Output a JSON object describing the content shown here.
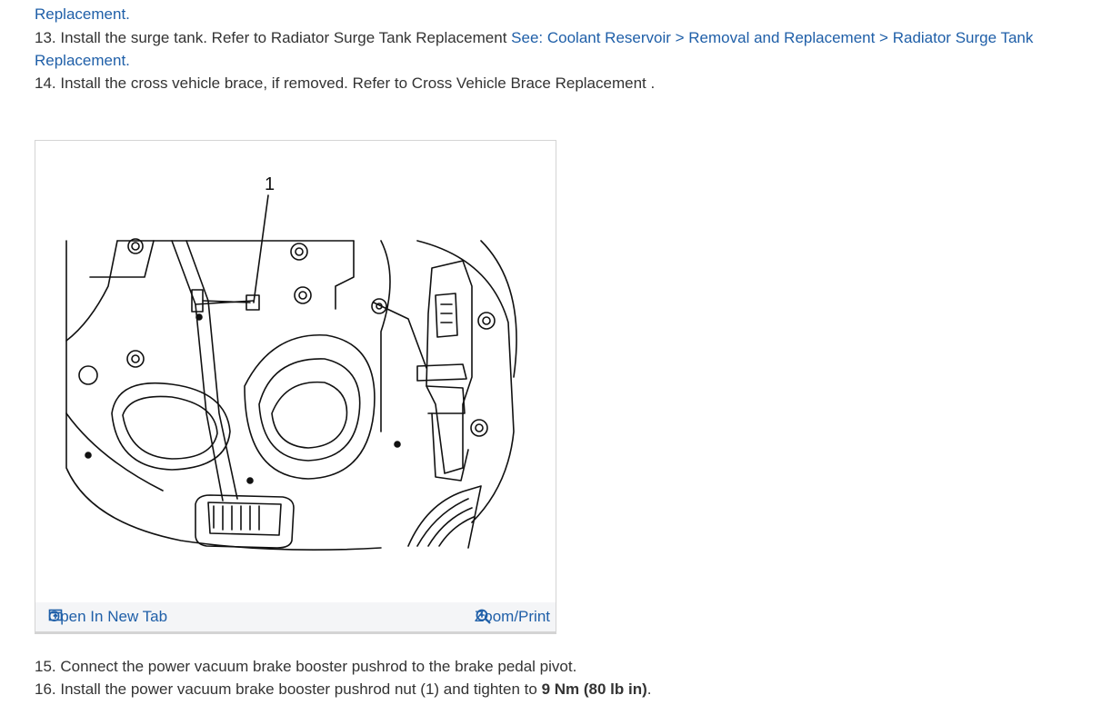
{
  "steps": {
    "s12_tail": "Replacement.",
    "s13_text": "13. Install the surge tank. Refer to Radiator Surge Tank Replacement ",
    "s13_link_a": "See: Coolant Reservoir > Removal and Replacement > Radiator Surge Tank",
    "s13_link_b": "Replacement.",
    "s14_text": "14. Install the cross vehicle brace, if removed. Refer to Cross Vehicle Brace Replacement .",
    "s15_text": "15. Connect the power vacuum brake booster pushrod to the brake pedal pivot.",
    "s16_text": "16. Install the power vacuum brake booster pushrod nut (1) and tighten to ",
    "s16_bold": "9 Nm (80 lb in)",
    "s16_end": "."
  },
  "figure": {
    "callout": "1",
    "open_label": "Open In New Tab",
    "zoom_label": "Zoom/Print",
    "open_icon": "open-in-new-tab-icon",
    "zoom_icon": "zoom-in-icon"
  },
  "colors": {
    "link": "#1f5fa8",
    "text": "#333333",
    "footer_bg": "#f4f5f7"
  }
}
